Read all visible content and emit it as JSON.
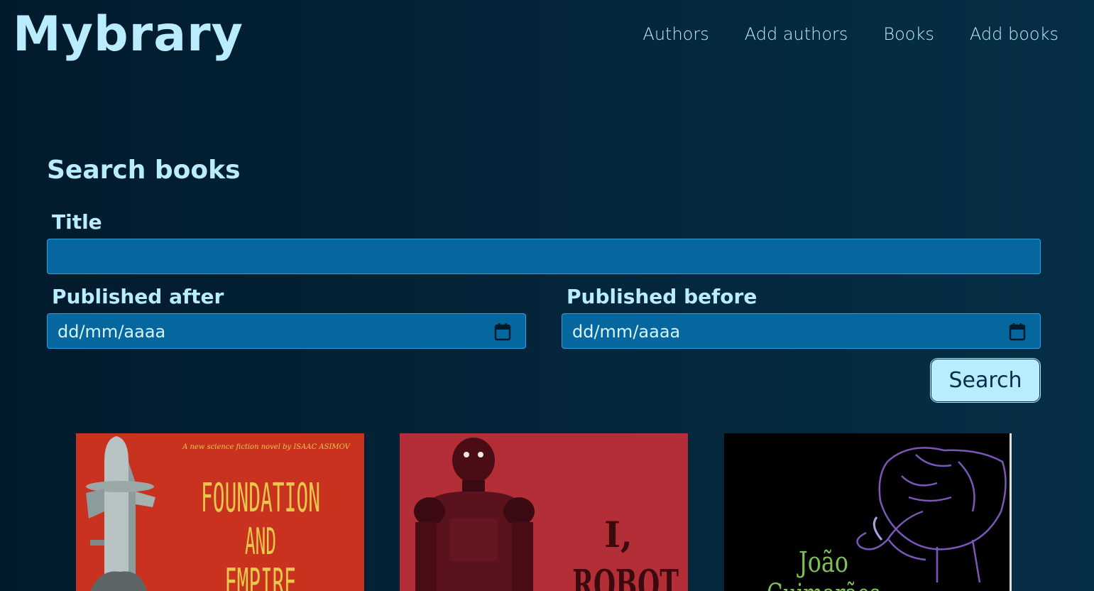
{
  "app": {
    "logo": "Mybrary"
  },
  "nav": {
    "items": [
      {
        "label": "Authors"
      },
      {
        "label": "Add authors"
      },
      {
        "label": "Books"
      },
      {
        "label": "Add books"
      }
    ]
  },
  "search": {
    "heading": "Search books",
    "title_label": "Title",
    "title_value": "",
    "published_after_label": "Published after",
    "published_after_value": "dd/mm/aaaa",
    "published_before_label": "Published before",
    "published_before_value": "dd/mm/aaaa",
    "button_label": "Search",
    "calendar_icon": "calendar-icon"
  },
  "books": [
    {
      "cover_lines": [
        "A new science fiction novel by ISAAC ASIMOV",
        "FOUNDATION",
        "AND",
        "EMPIRE"
      ],
      "colors": {
        "background": "#c8321e",
        "text": "#e7c84a"
      }
    },
    {
      "cover_lines": [
        "I,",
        "ROBOT"
      ],
      "colors": {
        "background": "#b0242e",
        "text": "#3a0a0e"
      }
    },
    {
      "cover_lines": [
        "João",
        "Guimarães"
      ],
      "colors": {
        "background": "#000000",
        "text": "#7fbf5a",
        "art": "#7a57b8"
      }
    }
  ],
  "colors": {
    "background_start": "#021b2c",
    "background_end": "#052f47",
    "accent": "#b9ecff",
    "input_bg": "#06679e"
  }
}
